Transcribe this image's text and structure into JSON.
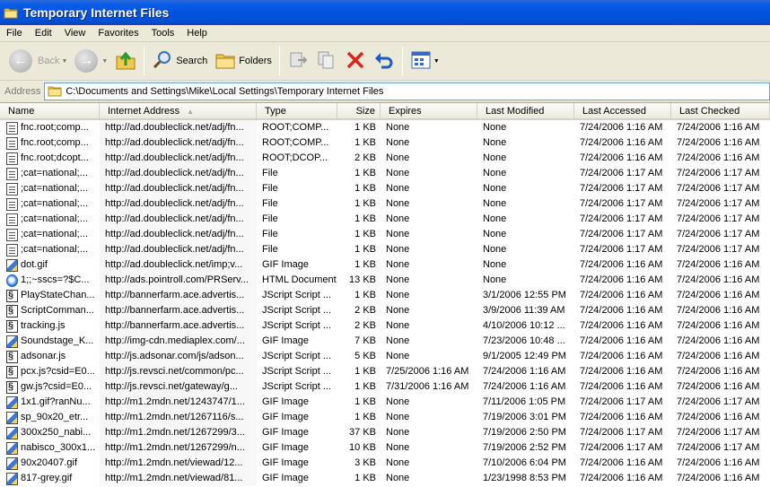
{
  "window": {
    "title": "Temporary Internet Files"
  },
  "menu": [
    "File",
    "Edit",
    "View",
    "Favorites",
    "Tools",
    "Help"
  ],
  "toolbar": {
    "back_label": "Back",
    "search_label": "Search",
    "folders_label": "Folders"
  },
  "address": {
    "label": "Address",
    "path": "C:\\Documents and Settings\\Mike\\Local Settings\\Temporary Internet Files"
  },
  "columns": [
    "Name",
    "Internet Address",
    "Type",
    "Size",
    "Expires",
    "Last Modified",
    "Last Accessed",
    "Last Checked"
  ],
  "sorted_column": "Internet Address",
  "rows": [
    {
      "icon": "file-icon",
      "name": "fnc.root;comp...",
      "address": "http://ad.doubleclick.net/adj/fn...",
      "type": "ROOT;COMP...",
      "size": "1 KB",
      "expires": "None",
      "modified": "None",
      "accessed": "7/24/2006 1:16 AM",
      "checked": "7/24/2006 1:16 AM"
    },
    {
      "icon": "file-icon",
      "name": "fnc.root;comp...",
      "address": "http://ad.doubleclick.net/adj/fn...",
      "type": "ROOT;COMP...",
      "size": "1 KB",
      "expires": "None",
      "modified": "None",
      "accessed": "7/24/2006 1:16 AM",
      "checked": "7/24/2006 1:16 AM"
    },
    {
      "icon": "file-icon",
      "name": "fnc.root;dcopt...",
      "address": "http://ad.doubleclick.net/adj/fn...",
      "type": "ROOT;DCOP...",
      "size": "2 KB",
      "expires": "None",
      "modified": "None",
      "accessed": "7/24/2006 1:16 AM",
      "checked": "7/24/2006 1:16 AM"
    },
    {
      "icon": "file-icon",
      "name": ";cat=national;...",
      "address": "http://ad.doubleclick.net/adj/fn...",
      "type": "File",
      "size": "1 KB",
      "expires": "None",
      "modified": "None",
      "accessed": "7/24/2006 1:17 AM",
      "checked": "7/24/2006 1:17 AM"
    },
    {
      "icon": "file-icon",
      "name": ";cat=national;...",
      "address": "http://ad.doubleclick.net/adj/fn...",
      "type": "File",
      "size": "1 KB",
      "expires": "None",
      "modified": "None",
      "accessed": "7/24/2006 1:17 AM",
      "checked": "7/24/2006 1:17 AM"
    },
    {
      "icon": "file-icon",
      "name": ";cat=national;...",
      "address": "http://ad.doubleclick.net/adj/fn...",
      "type": "File",
      "size": "1 KB",
      "expires": "None",
      "modified": "None",
      "accessed": "7/24/2006 1:17 AM",
      "checked": "7/24/2006 1:17 AM"
    },
    {
      "icon": "file-icon",
      "name": ";cat=national;...",
      "address": "http://ad.doubleclick.net/adj/fn...",
      "type": "File",
      "size": "1 KB",
      "expires": "None",
      "modified": "None",
      "accessed": "7/24/2006 1:17 AM",
      "checked": "7/24/2006 1:17 AM"
    },
    {
      "icon": "file-icon",
      "name": ";cat=national;...",
      "address": "http://ad.doubleclick.net/adj/fn...",
      "type": "File",
      "size": "1 KB",
      "expires": "None",
      "modified": "None",
      "accessed": "7/24/2006 1:17 AM",
      "checked": "7/24/2006 1:17 AM"
    },
    {
      "icon": "file-icon",
      "name": ";cat=national;...",
      "address": "http://ad.doubleclick.net/adj/fn...",
      "type": "File",
      "size": "1 KB",
      "expires": "None",
      "modified": "None",
      "accessed": "7/24/2006 1:17 AM",
      "checked": "7/24/2006 1:17 AM"
    },
    {
      "icon": "gif-image-icon",
      "name": "dot.gif",
      "address": "http://ad.doubleclick.net/imp;v...",
      "type": "GIF Image",
      "size": "1 KB",
      "expires": "None",
      "modified": "None",
      "accessed": "7/24/2006 1:16 AM",
      "checked": "7/24/2006 1:16 AM"
    },
    {
      "icon": "html-document-icon",
      "name": "1;;~sscs=?$C...",
      "address": "http://ads.pointroll.com/PRServ...",
      "type": "HTML Document",
      "size": "13 KB",
      "expires": "None",
      "modified": "None",
      "accessed": "7/24/2006 1:16 AM",
      "checked": "7/24/2006 1:16 AM"
    },
    {
      "icon": "jscript-icon",
      "name": "PlayStateChan...",
      "address": "http://bannerfarm.ace.advertis...",
      "type": "JScript Script ...",
      "size": "1 KB",
      "expires": "None",
      "modified": "3/1/2006 12:55 PM",
      "accessed": "7/24/2006 1:16 AM",
      "checked": "7/24/2006 1:16 AM"
    },
    {
      "icon": "jscript-icon",
      "name": "ScriptComman...",
      "address": "http://bannerfarm.ace.advertis...",
      "type": "JScript Script ...",
      "size": "2 KB",
      "expires": "None",
      "modified": "3/9/2006 11:39 AM",
      "accessed": "7/24/2006 1:16 AM",
      "checked": "7/24/2006 1:16 AM"
    },
    {
      "icon": "jscript-icon",
      "name": "tracking.js",
      "address": "http://bannerfarm.ace.advertis...",
      "type": "JScript Script ...",
      "size": "2 KB",
      "expires": "None",
      "modified": "4/10/2006 10:12 ...",
      "accessed": "7/24/2006 1:16 AM",
      "checked": "7/24/2006 1:16 AM"
    },
    {
      "icon": "gif-image-icon",
      "name": "Soundstage_K...",
      "address": "http://img-cdn.mediaplex.com/...",
      "type": "GIF Image",
      "size": "7 KB",
      "expires": "None",
      "modified": "7/23/2006 10:48 ...",
      "accessed": "7/24/2006 1:16 AM",
      "checked": "7/24/2006 1:16 AM"
    },
    {
      "icon": "jscript-icon",
      "name": "adsonar.js",
      "address": "http://js.adsonar.com/js/adson...",
      "type": "JScript Script ...",
      "size": "5 KB",
      "expires": "None",
      "modified": "9/1/2005 12:49 PM",
      "accessed": "7/24/2006 1:16 AM",
      "checked": "7/24/2006 1:16 AM"
    },
    {
      "icon": "jscript-icon",
      "name": "pcx.js?csid=E0...",
      "address": "http://js.revsci.net/common/pc...",
      "type": "JScript Script ...",
      "size": "1 KB",
      "expires": "7/25/2006 1:16 AM",
      "modified": "7/24/2006 1:16 AM",
      "accessed": "7/24/2006 1:16 AM",
      "checked": "7/24/2006 1:16 AM"
    },
    {
      "icon": "jscript-icon",
      "name": "gw.js?csid=E0...",
      "address": "http://js.revsci.net/gateway/g...",
      "type": "JScript Script ...",
      "size": "1 KB",
      "expires": "7/31/2006 1:16 AM",
      "modified": "7/24/2006 1:16 AM",
      "accessed": "7/24/2006 1:16 AM",
      "checked": "7/24/2006 1:16 AM"
    },
    {
      "icon": "gif-image-icon",
      "name": "1x1.gif?ranNu...",
      "address": "http://m1.2mdn.net/1243747/1...",
      "type": "GIF Image",
      "size": "1 KB",
      "expires": "None",
      "modified": "7/11/2006 1:05 PM",
      "accessed": "7/24/2006 1:17 AM",
      "checked": "7/24/2006 1:17 AM"
    },
    {
      "icon": "gif-image-icon",
      "name": "sp_90x20_etr...",
      "address": "http://m1.2mdn.net/1267116/s...",
      "type": "GIF Image",
      "size": "1 KB",
      "expires": "None",
      "modified": "7/19/2006 3:01 PM",
      "accessed": "7/24/2006 1:16 AM",
      "checked": "7/24/2006 1:16 AM"
    },
    {
      "icon": "gif-image-icon",
      "name": "300x250_nabi...",
      "address": "http://m1.2mdn.net/1267299/3...",
      "type": "GIF Image",
      "size": "37 KB",
      "expires": "None",
      "modified": "7/19/2006 2:50 PM",
      "accessed": "7/24/2006 1:17 AM",
      "checked": "7/24/2006 1:17 AM"
    },
    {
      "icon": "gif-image-icon",
      "name": "nabisco_300x1...",
      "address": "http://m1.2mdn.net/1267299/n...",
      "type": "GIF Image",
      "size": "10 KB",
      "expires": "None",
      "modified": "7/19/2006 2:52 PM",
      "accessed": "7/24/2006 1:17 AM",
      "checked": "7/24/2006 1:17 AM"
    },
    {
      "icon": "gif-image-icon",
      "name": "90x20407.gif",
      "address": "http://m1.2mdn.net/viewad/12...",
      "type": "GIF Image",
      "size": "3 KB",
      "expires": "None",
      "modified": "7/10/2006 6:04 PM",
      "accessed": "7/24/2006 1:16 AM",
      "checked": "7/24/2006 1:16 AM"
    },
    {
      "icon": "gif-image-icon",
      "name": "817-grey.gif",
      "address": "http://m1.2mdn.net/viewad/81...",
      "type": "GIF Image",
      "size": "1 KB",
      "expires": "None",
      "modified": "1/23/1998 8:53 PM",
      "accessed": "7/24/2006 1:16 AM",
      "checked": "7/24/2006 1:16 AM"
    }
  ]
}
